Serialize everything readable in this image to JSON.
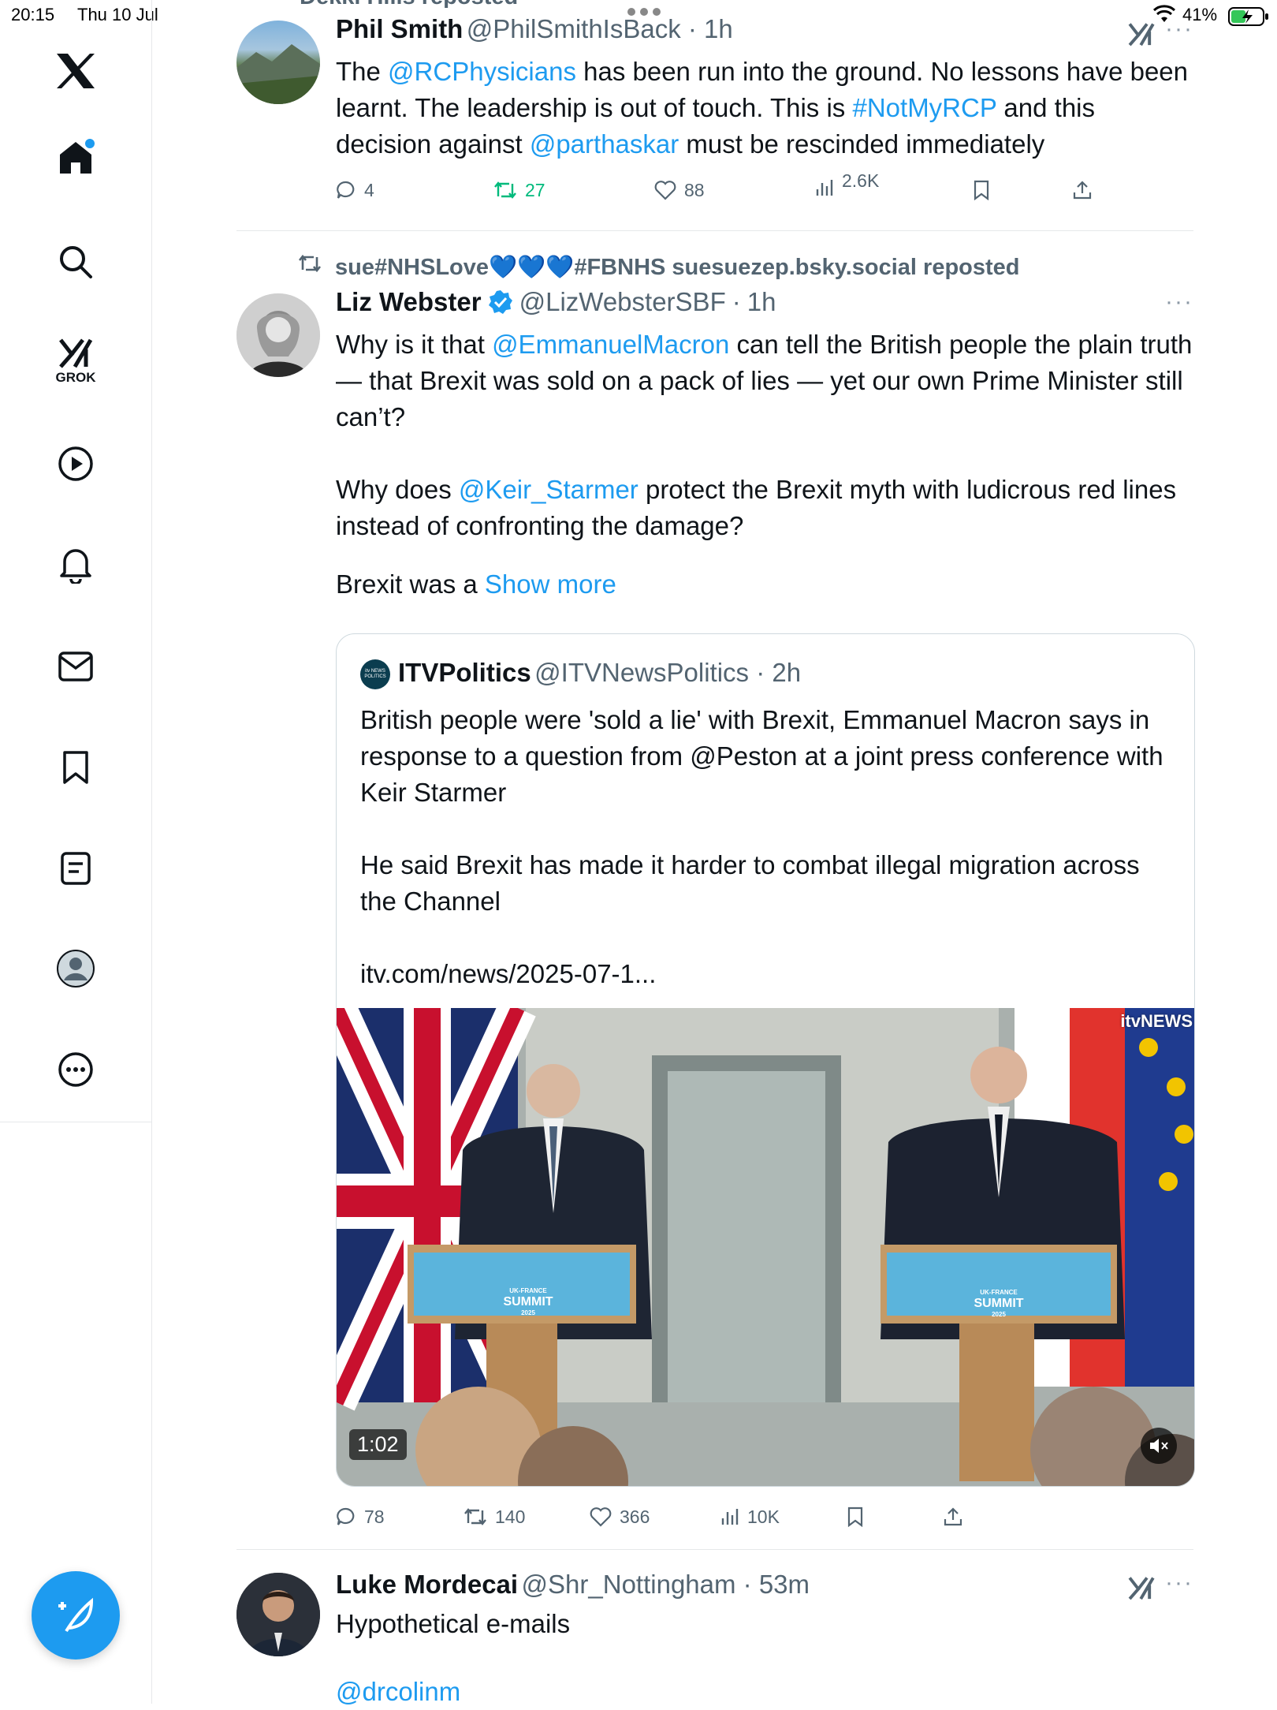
{
  "status_bar": {
    "time": "20:15",
    "date": "Thu 10 Jul",
    "battery": "41%"
  },
  "sidebar": {
    "grok_label": "GROK",
    "items": [
      "home",
      "search",
      "grok",
      "video",
      "notifications",
      "messages",
      "bookmarks",
      "lists",
      "profile",
      "more"
    ]
  },
  "colors": {
    "accent": "#1d9bf0",
    "repost_green": "#00ba7c",
    "text": "#0f1419",
    "muted": "#536471"
  },
  "tweets": [
    {
      "repost_line": "Dekki Hills reposted",
      "name": "Phil Smith",
      "handle": "@PhilSmithIsBack",
      "time": "1h",
      "text": {
        "p1": "The ",
        "m1": "@RCPhysicians",
        "p2": " has been run into the ground. No lessons have been learnt. The leadership is out of touch. This is ",
        "m2": "#NotMyRCP",
        "p3": " and this decision against ",
        "m3": "@parthaskar",
        "p4": " must be rescinded immediately"
      },
      "stats": {
        "replies": "4",
        "reposts": "27",
        "likes": "88",
        "views": "2.6K"
      }
    },
    {
      "repost_line": "sue#NHSLove💙💙💙#FBNHS suesuezep.bsky.social reposted",
      "name": "Liz Webster",
      "handle": "@LizWebsterSBF",
      "time": "1h",
      "text": {
        "a1": "Why is it that ",
        "a2": "@EmmanuelMacron",
        "a3": " can tell the British people the plain truth — that Brexit was sold on a pack of lies — yet our own Prime Minister still can’t?",
        "b1": "Why does ",
        "b2": "@Keir_Starmer",
        "b3": " protect the Brexit myth with ludicrous red lines instead of confronting the damage?",
        "c1": "Brexit was a ",
        "show_more": "Show more"
      },
      "quote": {
        "logo_text": "itv NEWS POLITICS",
        "name": "ITVPolitics",
        "handle": "@ITVNewsPolitics",
        "time": "2h",
        "p1": "British people were 'sold a lie' with Brexit, Emmanuel Macron says in response to a question from @Peston at a joint press conference with Keir Starmer",
        "p2": "He said Brexit has made it harder to combat illegal migration across the Channel",
        "p3": "itv.com/news/2025-07-1...",
        "video": {
          "duration": "1:02",
          "watermark": "itvNEWS",
          "podium_small": "UK-FRANCE",
          "podium_big": "SUMMIT",
          "podium_year": "2025"
        }
      },
      "stats": {
        "replies": "78",
        "reposts": "140",
        "likes": "366",
        "views": "10K"
      }
    },
    {
      "name": "Luke Mordecai",
      "handle": "@Shr_Nottingham",
      "time": "53m",
      "text": "Hypothetical e-mails",
      "mention": "@drcolinm"
    }
  ]
}
